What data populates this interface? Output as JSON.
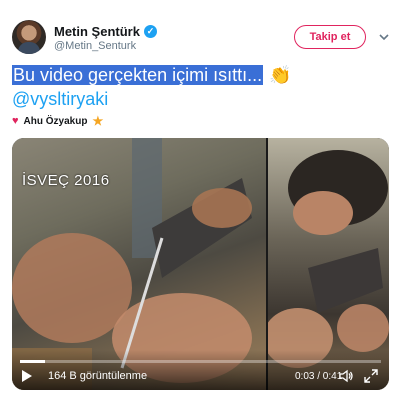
{
  "author": {
    "display_name": "Metin Şentürk",
    "handle": "@Metin_Senturk",
    "verified_icon": "verified-badge-icon"
  },
  "follow_button": {
    "label": "Takip et"
  },
  "tweet": {
    "text_selected": "Bu video gerçekten içimi ısıttı...",
    "emoji": "clapping-hands-icon",
    "mention": "@vysltiryaki"
  },
  "liked_by": {
    "name": "Ahu Özyakup",
    "icons": [
      "heart-icon",
      "star-icon"
    ]
  },
  "video": {
    "overlay_text": "İSVEÇ 2016",
    "views": "164 B görüntülenme",
    "time": "0:03 / 0:41",
    "progress": 0.07
  },
  "colors": {
    "accent_blue": "#1da1f2",
    "follow_red": "#e0245e",
    "selection_blue": "#3a6fd6",
    "star_yellow": "#f5a623"
  }
}
